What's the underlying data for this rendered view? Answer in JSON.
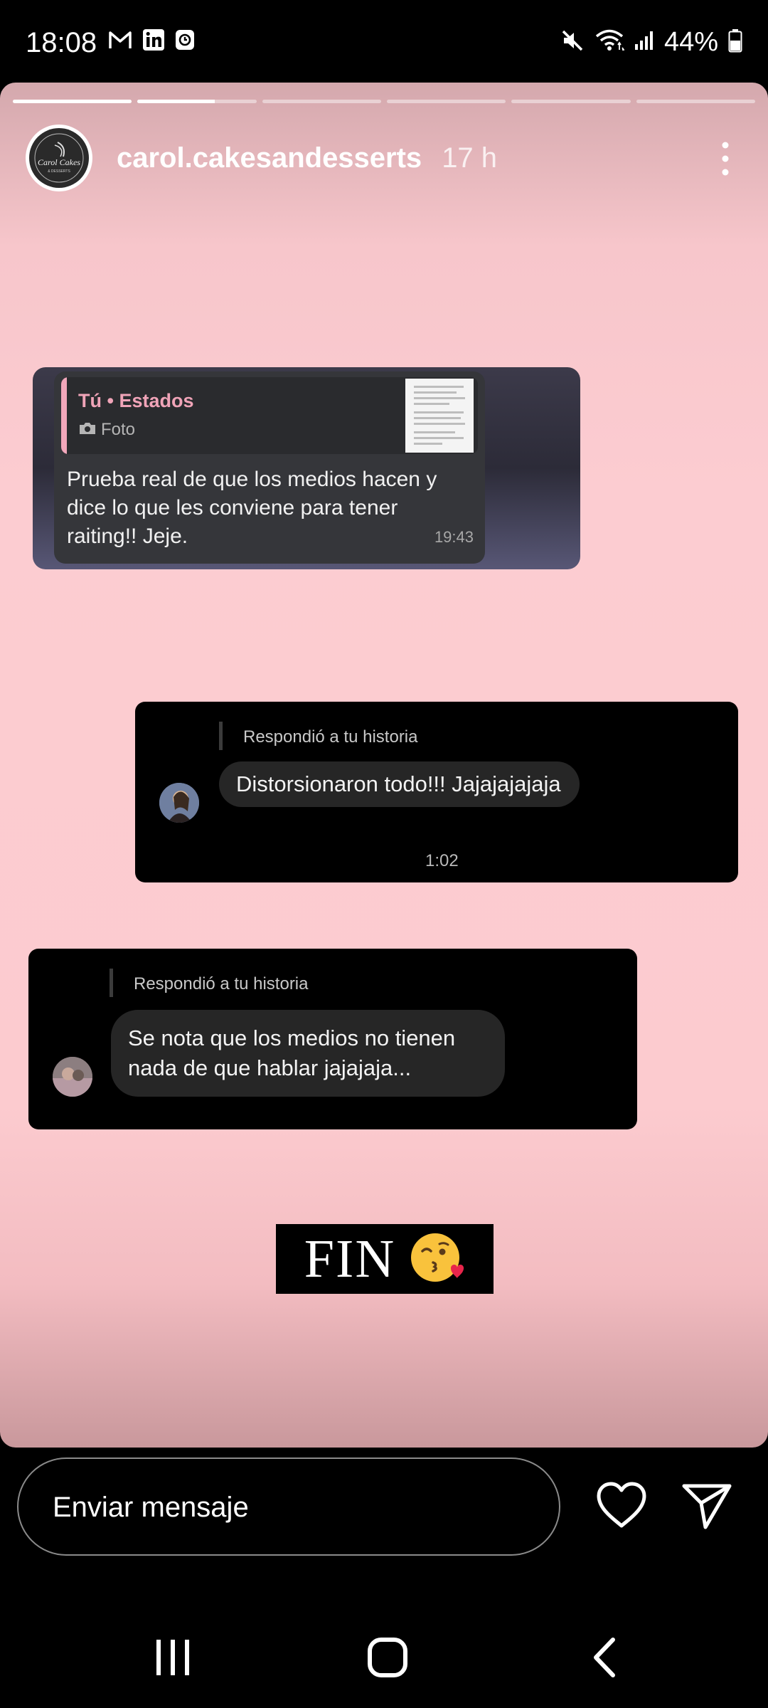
{
  "status_bar": {
    "time": "18:08",
    "battery": "44%",
    "left_icons": [
      "gmail-icon",
      "linkedin-icon",
      "clock-app-icon"
    ],
    "right_icons": [
      "mute-icon",
      "wifi-icon",
      "signal-icon",
      "battery-icon"
    ]
  },
  "story": {
    "segments_total": 6,
    "segments_viewed": 1,
    "current_progress": 0.65,
    "username": "carol.cakesandesserts",
    "time_ago": "17 h",
    "avatar_text": "Carol Cakes"
  },
  "screenshot1": {
    "reply_title": "Tú • Estados",
    "reply_sub": "Foto",
    "message": "Prueba real de que los medios hacen y dice lo que les conviene para tener raiting!! Jeje.",
    "time": "19:43"
  },
  "screenshot2": {
    "replied_label": "Respondió a tu historia",
    "message": "Distorsionaron todo!!! Jajajajajaja",
    "time": "1:02"
  },
  "screenshot3": {
    "replied_label": "Respondió a tu historia",
    "message_line1": "Se nota que los medios no tienen",
    "message_line2": "nada de que hablar jajajaja..."
  },
  "fin": {
    "text": "FIN",
    "emoji": "😘"
  },
  "composer": {
    "placeholder": "Enviar mensaje"
  },
  "colors": {
    "story_bg": "#fccbcf",
    "reply_accent": "#f0a4b8",
    "bubble_dark": "#262626"
  }
}
